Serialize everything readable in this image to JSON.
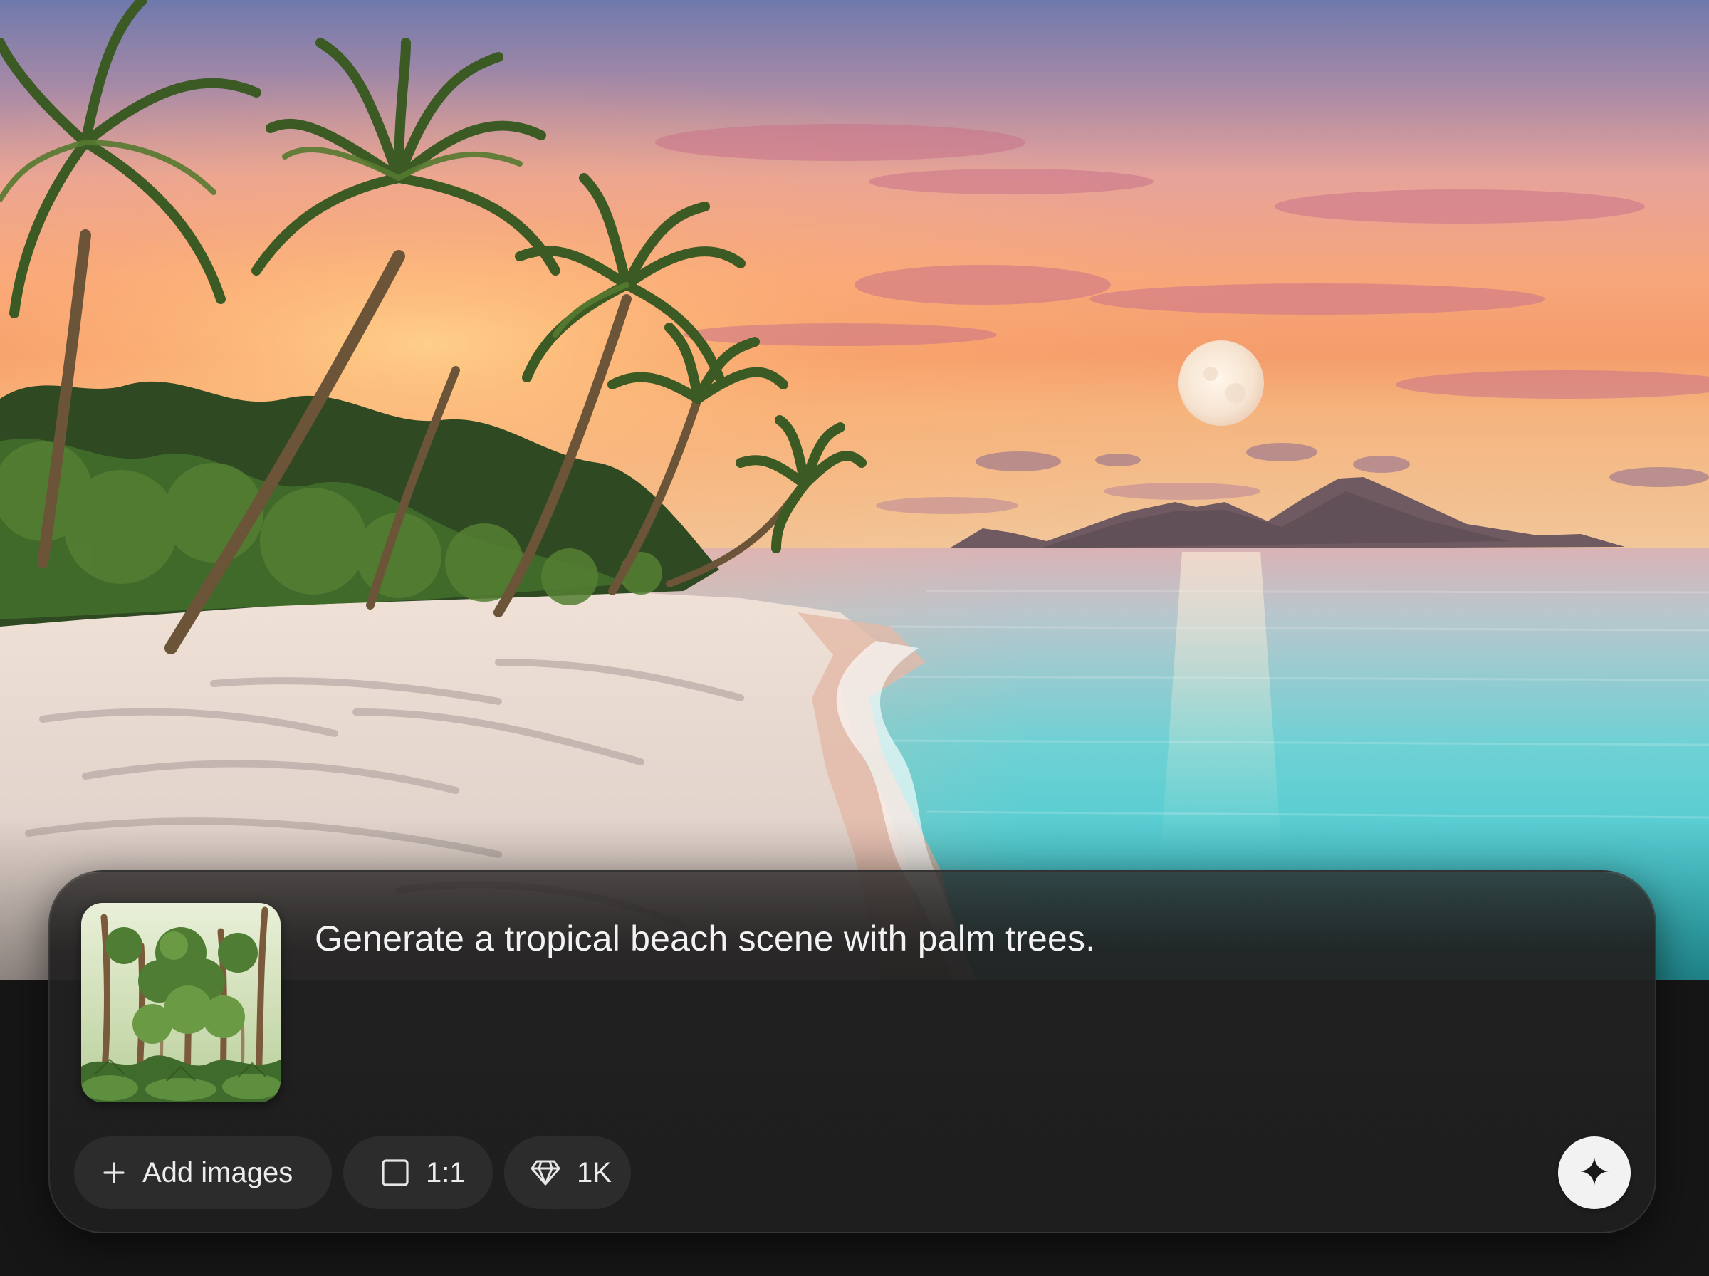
{
  "hero_image": {
    "subject": "tropical-beach-sunset"
  },
  "composer": {
    "reference_image": {
      "subject": "jungle-forest-illustration"
    },
    "prompt_text": "Generate a tropical beach scene with palm trees.",
    "chips": {
      "add_images": {
        "label": "Add images",
        "icon": "plus-icon"
      },
      "aspect_ratio": {
        "label": "1:1",
        "icon": "square-icon"
      },
      "resolution": {
        "label": "1K",
        "icon": "diamond-icon"
      }
    },
    "send_button": {
      "icon": "sparkle-icon"
    }
  },
  "colors": {
    "panel_bg": "#222222",
    "chip_bg": "#2c2c2c",
    "send_bg": "#f2f2f2",
    "text": "#f2f2f2"
  }
}
